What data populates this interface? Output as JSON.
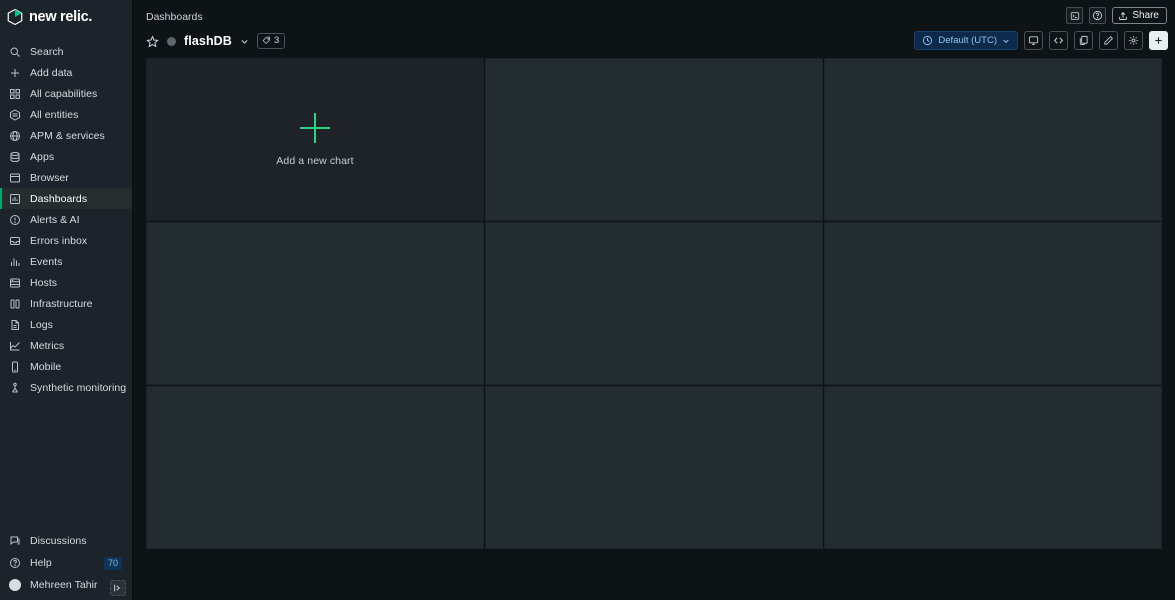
{
  "brand": {
    "name": "new relic.",
    "logo_icon": "new-relic-cube-logo",
    "accent_green": "#00ac69",
    "plus_green": "#2fd07f"
  },
  "sidebar": {
    "items": [
      {
        "label": "Search",
        "icon": "search-icon",
        "active": false
      },
      {
        "label": "Add data",
        "icon": "plus-icon",
        "active": false
      },
      {
        "label": "All capabilities",
        "icon": "grid-squares-icon",
        "active": false
      },
      {
        "label": "All entities",
        "icon": "hexagon-list-icon",
        "active": false
      },
      {
        "label": "APM & services",
        "icon": "globe-icon",
        "active": false
      },
      {
        "label": "Apps",
        "icon": "stack-layers-icon",
        "active": false
      },
      {
        "label": "Browser",
        "icon": "browser-window-icon",
        "active": false
      },
      {
        "label": "Dashboards",
        "icon": "dashboard-icon",
        "active": true
      },
      {
        "label": "Alerts & AI",
        "icon": "alert-circle-icon",
        "active": false
      },
      {
        "label": "Errors inbox",
        "icon": "inbox-icon",
        "active": false
      },
      {
        "label": "Events",
        "icon": "bar-chart-icon",
        "active": false
      },
      {
        "label": "Hosts",
        "icon": "server-icon",
        "active": false
      },
      {
        "label": "Infrastructure",
        "icon": "infrastructure-icon",
        "active": false
      },
      {
        "label": "Logs",
        "icon": "document-lines-icon",
        "active": false
      },
      {
        "label": "Metrics",
        "icon": "line-chart-icon",
        "active": false
      },
      {
        "label": "Mobile",
        "icon": "mobile-phone-icon",
        "active": false
      },
      {
        "label": "Synthetic monitoring",
        "icon": "synthetic-monitor-icon",
        "active": false
      }
    ],
    "bottom_items": [
      {
        "label": "Discussions",
        "icon": "chat-bubble-icon",
        "badge": ""
      },
      {
        "label": "Help",
        "icon": "help-circle-icon",
        "badge": "70"
      },
      {
        "label": "Mehreen Tahir",
        "icon": "user-avatar",
        "badge": ""
      }
    ],
    "collapse_icon": "collapse-panel-icon"
  },
  "header": {
    "breadcrumb": "Dashboards",
    "favorite_icon": "star-outline-icon",
    "status_icon": "status-dot",
    "title": "flashDB",
    "title_chevron_icon": "chevron-down-icon",
    "tag_icon": "tag-icon",
    "tag_count": "3",
    "top_icons": [
      {
        "name": "terminal-console-icon"
      },
      {
        "name": "help-question-icon"
      }
    ],
    "share": {
      "label": "Share",
      "icon": "share-upload-icon"
    }
  },
  "toolbar": {
    "time_picker": {
      "icon": "clock-icon",
      "value": "Default (UTC)",
      "chevron_icon": "chevron-down-icon"
    },
    "buttons": [
      {
        "name": "fullscreen-tv-button",
        "icon": "monitor-screen-icon",
        "accent": false
      },
      {
        "name": "view-code-button",
        "icon": "code-brackets-icon",
        "accent": false
      },
      {
        "name": "duplicate-button",
        "icon": "copy-pages-icon",
        "accent": false
      },
      {
        "name": "edit-button",
        "icon": "pencil-icon",
        "accent": false
      },
      {
        "name": "settings-button",
        "icon": "gear-icon",
        "accent": false
      },
      {
        "name": "add-widget-button",
        "icon": "plus-icon",
        "accent": true
      }
    ]
  },
  "main": {
    "add_chart": {
      "label": "Add a new chart",
      "icon": "plus-large-icon"
    },
    "grid": {
      "columns": 3,
      "rows": 3,
      "empty_cells": 8
    }
  }
}
